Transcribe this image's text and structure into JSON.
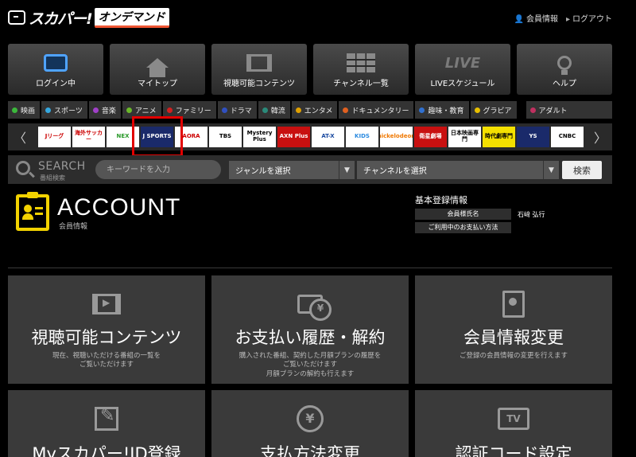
{
  "header": {
    "logo_main": "スカパー!",
    "logo_sub": "オンデマンド",
    "member_info": "会員情報",
    "logout": "ログアウト"
  },
  "nav": [
    {
      "label": "ログイン中",
      "icon": "login-tv-icon"
    },
    {
      "label": "マイトップ",
      "icon": "home-icon"
    },
    {
      "label": "視聴可能コンテンツ",
      "icon": "film-icon"
    },
    {
      "label": "チャンネル一覧",
      "icon": "grid-icon"
    },
    {
      "label": "LIVEスケジュール",
      "icon": "live-icon"
    },
    {
      "label": "ヘルプ",
      "icon": "lightbulb-icon"
    }
  ],
  "live_glyph": "LIVE",
  "genres": [
    {
      "label": "映画",
      "color": "#3cb83c"
    },
    {
      "label": "スポーツ",
      "color": "#35a8e0"
    },
    {
      "label": "音楽",
      "color": "#a040c8"
    },
    {
      "label": "アニメ",
      "color": "#6ab82a"
    },
    {
      "label": "ファミリー",
      "color": "#d02020"
    },
    {
      "label": "ドラマ",
      "color": "#3050c0"
    },
    {
      "label": "韓流",
      "color": "#2a8a7a"
    },
    {
      "label": "エンタメ",
      "color": "#e0a000"
    },
    {
      "label": "ドキュメンタリー",
      "color": "#e06020"
    },
    {
      "label": "趣味・教育",
      "color": "#3070d0"
    },
    {
      "label": "グラビア",
      "color": "#e8c000"
    },
    {
      "label": "アダルト",
      "color": "#c03060"
    }
  ],
  "channels": [
    {
      "label": "Jリーグ"
    },
    {
      "label": "海外サッカー"
    },
    {
      "label": "NEX"
    },
    {
      "label": "J SPORTS"
    },
    {
      "label": "AORA"
    },
    {
      "label": "TBS"
    },
    {
      "label": "Mystery Plus"
    },
    {
      "label": "AXN Plus"
    },
    {
      "label": "AT-X"
    },
    {
      "label": "KIDS"
    },
    {
      "label": "nickelodeon"
    },
    {
      "label": "衛星劇場"
    },
    {
      "label": "日本映画専門"
    },
    {
      "label": "時代劇専門"
    },
    {
      "label": "YS"
    },
    {
      "label": "CNBC"
    }
  ],
  "search": {
    "title": "SEARCH",
    "subtitle": "番組検索",
    "placeholder": "キーワードを入力",
    "genre_select": "ジャンルを選択",
    "channel_select": "チャンネルを選択",
    "button": "検索"
  },
  "account": {
    "title": "ACCOUNT",
    "subtitle": "会員情報",
    "info_title": "基本登録情報",
    "rows": [
      {
        "key": "会員様氏名",
        "value": "石﨑 弘行"
      },
      {
        "key": "ご利用中のお支払い方法",
        "value": ""
      }
    ]
  },
  "cards": [
    {
      "title": "視聴可能コンテンツ",
      "desc": "現在、視聴いただける番組の一覧を\nご覧いただけます",
      "icon": "film-stack-icon"
    },
    {
      "title": "お支払い履歴・解約",
      "desc": "購入された番組、契約した月額プランの履歴を\nご覧いただけます\n月額プランの解約も行えます",
      "icon": "payment-yen-icon"
    },
    {
      "title": "会員情報変更",
      "desc": "ご登録の会員情報の変更を行えます",
      "icon": "member-doc-icon"
    },
    {
      "title": "Myスカパー!ID登録",
      "desc": "",
      "icon": "edit-pen-icon"
    },
    {
      "title": "支払方法変更",
      "desc": "",
      "icon": "yen-coin-icon"
    },
    {
      "title": "認証コード設定",
      "desc": "",
      "icon": "tv-icon"
    }
  ],
  "glyphs": {
    "yen": "¥",
    "tv": "TV",
    "arrow_left": "〈",
    "arrow_right": "〉",
    "caret": "▼",
    "person": "👤",
    "triangle": "▸"
  }
}
